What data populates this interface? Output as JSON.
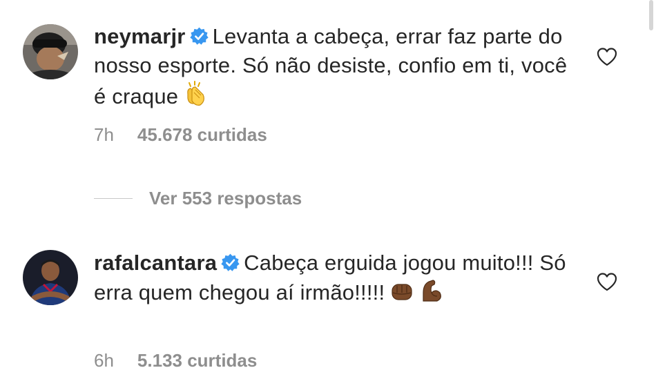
{
  "colors": {
    "text": "#262626",
    "secondary": "#8e8e8e",
    "verified": "#3897f0",
    "divider": "#c7c7c7"
  },
  "comments": [
    {
      "username": "neymarjr",
      "verified": true,
      "text": "Levanta a cabeça, errar faz parte do nosso esporte. Só não desiste, confio em ti, você é craque",
      "emoji": [
        "clapping-hands"
      ],
      "time": "7h",
      "likes": "45.678 curtidas",
      "replies": "Ver 553 respostas"
    },
    {
      "username": "rafalcantara",
      "verified": true,
      "text": "Cabeça erguida jogou muito!!! Só erra quem chegou aí irmão!!!!!",
      "emoji": [
        "oncoming-fist",
        "flexed-biceps"
      ],
      "time": "6h",
      "likes": "5.133 curtidas"
    }
  ]
}
